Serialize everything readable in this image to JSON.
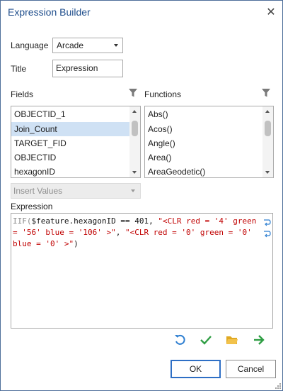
{
  "dialog": {
    "title": "Expression Builder",
    "close_glyph": "✕"
  },
  "language": {
    "label": "Language",
    "value": "Arcade"
  },
  "title_field": {
    "label": "Title",
    "value": "Expression"
  },
  "fields": {
    "label": "Fields",
    "items": [
      "OBJECTID_1",
      "Join_Count",
      "TARGET_FID",
      "OBJECTID",
      "hexagonID"
    ],
    "selected_index": 1
  },
  "functions": {
    "label": "Functions",
    "items": [
      "Abs()",
      "Acos()",
      "Angle()",
      "Area()",
      "AreaGeodetic()"
    ]
  },
  "insert_values": {
    "label": "Insert Values"
  },
  "expression": {
    "label": "Expression",
    "line1": {
      "kw": "IIF(",
      "var": "$feature.hexagonID",
      "op": " == ",
      "num": "401",
      "sep": ", ",
      "str": "\"<CLR red = '4' green"
    },
    "line2": {
      "str1": "= '56' blue = '106' >\"",
      "sep": ", ",
      "str2": "\"<CLR red = '0' green = '0'"
    },
    "line3": {
      "str": "blue = '0' >\"",
      "close": ")"
    }
  },
  "toolbar": {
    "icons": [
      "undo-icon",
      "verify-check-icon",
      "folder-open-icon",
      "arrow-right-icon"
    ],
    "colors": {
      "undo": "#2e7fd1",
      "check": "#2f9e44",
      "folder": "#e0a923",
      "arrow": "#2f9e44"
    }
  },
  "buttons": {
    "ok": "OK",
    "cancel": "Cancel"
  },
  "colors": {
    "title": "#1f4e8c",
    "selection": "#cfe1f4",
    "string": "#c00000",
    "ok_border": "#2e6fc5"
  }
}
